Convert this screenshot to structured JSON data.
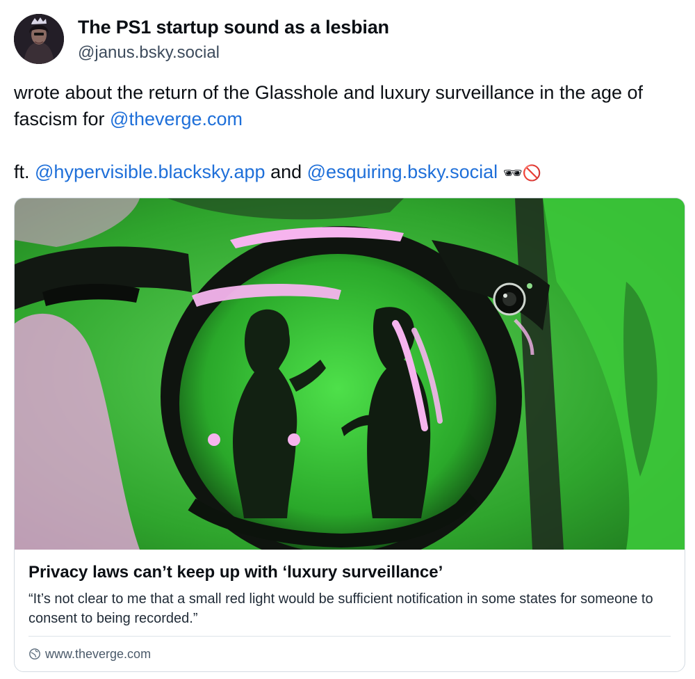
{
  "author": {
    "display_name": "The PS1 startup sound as a lesbian",
    "handle": "@janus.bsky.social"
  },
  "post": {
    "line1_text": "wrote about the return of the Glasshole and luxury surveillance in the age of fascism for ",
    "line1_mention": "@theverge.com",
    "line2_prefix": "ft. ",
    "line2_mention1": "@hypervisible.blacksky.app",
    "line2_and": " and ",
    "line2_mention2": "@esquiring.bsky.social",
    "emojis": "🕶🚫"
  },
  "link_card": {
    "image_description_icon": "sunglasses-reflection-image",
    "title": "Privacy laws can’t keep up with ‘luxury surveillance’",
    "description": "“It’s not clear to me that a small red light would be sufficient notification in some states for someone to consent to being recorded.”",
    "domain": "www.theverge.com",
    "domain_icon": "globe-icon"
  },
  "colors": {
    "mention": "#1e6fd9",
    "image_green": "#3ec43c",
    "image_pink": "#f2a6e6"
  }
}
